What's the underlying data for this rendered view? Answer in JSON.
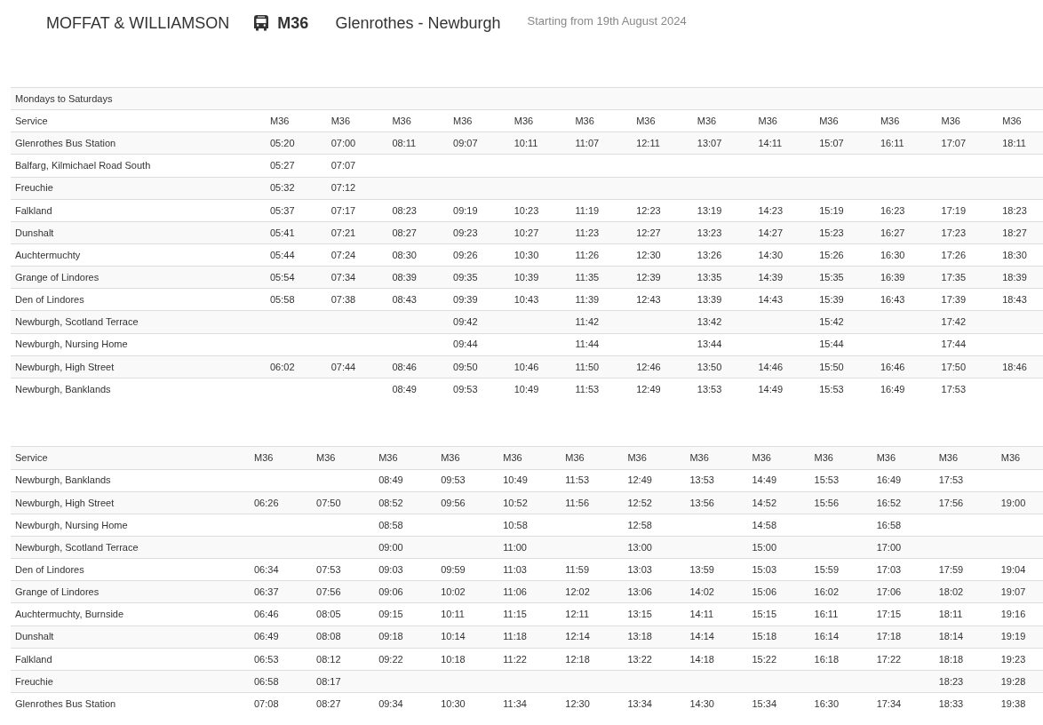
{
  "header": {
    "operator": "MOFFAT & WILLIAMSON",
    "route": "M36",
    "destinations": "Glenrothes - Newburgh",
    "starting": "Starting from 19th August 2024"
  },
  "timetables": [
    {
      "title": "Mondays to Saturdays",
      "service_label": "Service",
      "services": [
        "M36",
        "M36",
        "M36",
        "M36",
        "M36",
        "M36",
        "M36",
        "M36",
        "M36",
        "M36",
        "M36",
        "M36",
        "M36"
      ],
      "rows": [
        {
          "stop": "Glenrothes Bus Station",
          "times": {
            "col_1": "05:20",
            "col_2": "07:00",
            "col_3": "08:11",
            "col_4": "09:07",
            "col_5": "10:11",
            "col_6": "11:07",
            "col_7": "12:11",
            "col_8": "13:07",
            "col_9": "14:11",
            "col_10": "15:07",
            "col_11": "16:11",
            "col_12": "17:07",
            "col_13": "18:11"
          }
        },
        {
          "stop": "Balfarg, Kilmichael Road South",
          "times": {
            "col_1": "05:27",
            "col_2": "07:07"
          }
        },
        {
          "stop": "Freuchie",
          "times": {
            "col_1": "05:32",
            "col_2": "07:12"
          }
        },
        {
          "stop": "Falkland",
          "times": {
            "col_1": "05:37",
            "col_2": "07:17",
            "col_3": "08:23",
            "col_4": "09:19",
            "col_5": "10:23",
            "col_6": "11:19",
            "col_7": "12:23",
            "col_8": "13:19",
            "col_9": "14:23",
            "col_10": "15:19",
            "col_11": "16:23",
            "col_12": "17:19",
            "col_13": "18:23"
          }
        },
        {
          "stop": "Dunshalt",
          "times": {
            "col_1": "05:41",
            "col_2": "07:21",
            "col_3": "08:27",
            "col_4": "09:23",
            "col_5": "10:27",
            "col_6": "11:23",
            "col_7": "12:27",
            "col_8": "13:23",
            "col_9": "14:27",
            "col_10": "15:23",
            "col_11": "16:27",
            "col_12": "17:23",
            "col_13": "18:27"
          }
        },
        {
          "stop": "Auchtermuchty",
          "times": {
            "col_1": "05:44",
            "col_2": "07:24",
            "col_3": "08:30",
            "col_4": "09:26",
            "col_5": "10:30",
            "col_6": "11:26",
            "col_7": "12:30",
            "col_8": "13:26",
            "col_9": "14:30",
            "col_10": "15:26",
            "col_11": "16:30",
            "col_12": "17:26",
            "col_13": "18:30"
          }
        },
        {
          "stop": "Grange of Lindores",
          "times": {
            "col_1": "05:54",
            "col_2": "07:34",
            "col_3": "08:39",
            "col_4": "09:35",
            "col_5": "10:39",
            "col_6": "11:35",
            "col_7": "12:39",
            "col_8": "13:35",
            "col_9": "14:39",
            "col_10": "15:35",
            "col_11": "16:39",
            "col_12": "17:35",
            "col_13": "18:39"
          }
        },
        {
          "stop": "Den of Lindores",
          "times": {
            "col_1": "05:58",
            "col_2": "07:38",
            "col_3": "08:43",
            "col_4": "09:39",
            "col_5": "10:43",
            "col_6": "11:39",
            "col_7": "12:43",
            "col_8": "13:39",
            "col_9": "14:43",
            "col_10": "15:39",
            "col_11": "16:43",
            "col_12": "17:39",
            "col_13": "18:43"
          }
        },
        {
          "stop": "Newburgh, Scotland Terrace",
          "times": {
            "col_4": "09:42",
            "col_6": "11:42",
            "col_8": "13:42",
            "col_10": "15:42",
            "col_12": "17:42"
          }
        },
        {
          "stop": "Newburgh, Nursing Home",
          "times": {
            "col_4": "09:44",
            "col_6": "11:44",
            "col_8": "13:44",
            "col_10": "15:44",
            "col_12": "17:44"
          }
        },
        {
          "stop": "Newburgh, High Street",
          "times": {
            "col_1": "06:02",
            "col_2": "07:44",
            "col_3": "08:46",
            "col_4": "09:50",
            "col_5": "10:46",
            "col_6": "11:50",
            "col_7": "12:46",
            "col_8": "13:50",
            "col_9": "14:46",
            "col_10": "15:50",
            "col_11": "16:46",
            "col_12": "17:50",
            "col_13": "18:46"
          }
        },
        {
          "stop": "Newburgh, Banklands",
          "times": {
            "col_3": "08:49",
            "col_4": "09:53",
            "col_5": "10:49",
            "col_6": "11:53",
            "col_7": "12:49",
            "col_8": "13:53",
            "col_9": "14:49",
            "col_10": "15:53",
            "col_11": "16:49",
            "col_12": "17:53"
          }
        }
      ]
    },
    {
      "service_label": "Service",
      "services": [
        "M36",
        "M36",
        "M36",
        "M36",
        "M36",
        "M36",
        "M36",
        "M36",
        "M36",
        "M36",
        "M36",
        "M36",
        "M36"
      ],
      "rows": [
        {
          "stop": "Newburgh, Banklands",
          "times": {
            "col_3": "08:49",
            "col_4": "09:53",
            "col_5": "10:49",
            "col_6": "11:53",
            "col_7": "12:49",
            "col_8": "13:53",
            "col_9": "14:49",
            "col_10": "15:53",
            "col_11": "16:49",
            "col_12": "17:53"
          }
        },
        {
          "stop": "Newburgh, High Street",
          "times": {
            "col_1": "06:26",
            "col_2": "07:50",
            "col_3": "08:52",
            "col_4": "09:56",
            "col_5": "10:52",
            "col_6": "11:56",
            "col_7": "12:52",
            "col_8": "13:56",
            "col_9": "14:52",
            "col_10": "15:56",
            "col_11": "16:52",
            "col_12": "17:56",
            "col_13": "19:00"
          }
        },
        {
          "stop": "Newburgh, Nursing Home",
          "times": {
            "col_3": "08:58",
            "col_5": "10:58",
            "col_7": "12:58",
            "col_9": "14:58",
            "col_11": "16:58"
          }
        },
        {
          "stop": "Newburgh, Scotland Terrace",
          "times": {
            "col_3": "09:00",
            "col_5": "11:00",
            "col_7": "13:00",
            "col_9": "15:00",
            "col_11": "17:00"
          }
        },
        {
          "stop": "Den of Lindores",
          "times": {
            "col_1": "06:34",
            "col_2": "07:53",
            "col_3": "09:03",
            "col_4": "09:59",
            "col_5": "11:03",
            "col_6": "11:59",
            "col_7": "13:03",
            "col_8": "13:59",
            "col_9": "15:03",
            "col_10": "15:59",
            "col_11": "17:03",
            "col_12": "17:59",
            "col_13": "19:04"
          }
        },
        {
          "stop": "Grange of Lindores",
          "times": {
            "col_1": "06:37",
            "col_2": "07:56",
            "col_3": "09:06",
            "col_4": "10:02",
            "col_5": "11:06",
            "col_6": "12:02",
            "col_7": "13:06",
            "col_8": "14:02",
            "col_9": "15:06",
            "col_10": "16:02",
            "col_11": "17:06",
            "col_12": "18:02",
            "col_13": "19:07"
          }
        },
        {
          "stop": "Auchtermuchty, Burnside",
          "times": {
            "col_1": "06:46",
            "col_2": "08:05",
            "col_3": "09:15",
            "col_4": "10:11",
            "col_5": "11:15",
            "col_6": "12:11",
            "col_7": "13:15",
            "col_8": "14:11",
            "col_9": "15:15",
            "col_10": "16:11",
            "col_11": "17:15",
            "col_12": "18:11",
            "col_13": "19:16"
          }
        },
        {
          "stop": "Dunshalt",
          "times": {
            "col_1": "06:49",
            "col_2": "08:08",
            "col_3": "09:18",
            "col_4": "10:14",
            "col_5": "11:18",
            "col_6": "12:14",
            "col_7": "13:18",
            "col_8": "14:14",
            "col_9": "15:18",
            "col_10": "16:14",
            "col_11": "17:18",
            "col_12": "18:14",
            "col_13": "19:19"
          }
        },
        {
          "stop": "Falkland",
          "times": {
            "col_1": "06:53",
            "col_2": "08:12",
            "col_3": "09:22",
            "col_4": "10:18",
            "col_5": "11:22",
            "col_6": "12:18",
            "col_7": "13:22",
            "col_8": "14:18",
            "col_9": "15:22",
            "col_10": "16:18",
            "col_11": "17:22",
            "col_12": "18:18",
            "col_13": "19:23"
          }
        },
        {
          "stop": "Freuchie",
          "times": {
            "col_1": "06:58",
            "col_2": "08:17",
            "col_12": "18:23",
            "col_13": "19:28"
          }
        },
        {
          "stop": "Glenrothes Bus Station",
          "times": {
            "col_1": "07:08",
            "col_2": "08:27",
            "col_3": "09:34",
            "col_4": "10:30",
            "col_5": "11:34",
            "col_6": "12:30",
            "col_7": "13:34",
            "col_8": "14:30",
            "col_9": "15:34",
            "col_10": "16:30",
            "col_11": "17:34",
            "col_12": "18:33",
            "col_13": "19:38"
          }
        }
      ]
    }
  ]
}
